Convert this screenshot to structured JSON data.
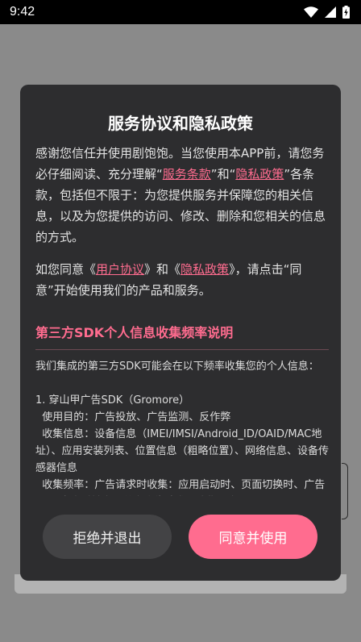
{
  "status_bar": {
    "time": "9:42",
    "icons": [
      "wifi-icon",
      "cellular-signal-icon",
      "battery-charging-icon"
    ]
  },
  "dialog": {
    "title": "服务协议和隐私政策",
    "intro": {
      "part1": "感谢您信任并使用剧饱饱。当您使用本APP前，请您务必仔细阅读、充分理解“",
      "link1": "服务条款",
      "part2": "”和“",
      "link2": "隐私政策",
      "part3": "”各条款，包括但不限于：为您提供服务并保障您的相关信息，以及为您提供的访问、修改、删除和您相关的信息的方式。"
    },
    "consent": {
      "part1": "如您同意《",
      "link1": "用户协议",
      "part2": "》和《",
      "link2": "隐私政策",
      "part3": "》，请点击“同意”开始使用我们的产品和服务。"
    },
    "sdk_heading": "第三方SDK个人信息收集频率说明",
    "sdk_text": "我们集成的第三方SDK可能会在以下频率收集您的个人信息：\n\n1. 穿山甲广告SDK（Gromore）\n  使用目的：广告投放、广告监测、反作弊\n  收集信息：设备信息（IMEI/IMSI/Android_ID/OAID/MAC地址）、应用安装列表、位置信息（粗略位置）、网络信息、设备传感器信息\n  收集频率：广告请求时收集：应用启动时、页面切换时、广告展示/点击时触发，单次广告请求仅收集一次",
    "reject_label": "拒绝并退出",
    "agree_label": "同意并使用"
  },
  "colors": {
    "accent": "#ff6c8f",
    "dialog_bg": "#2d2d2f",
    "reject_bg": "#434345"
  }
}
